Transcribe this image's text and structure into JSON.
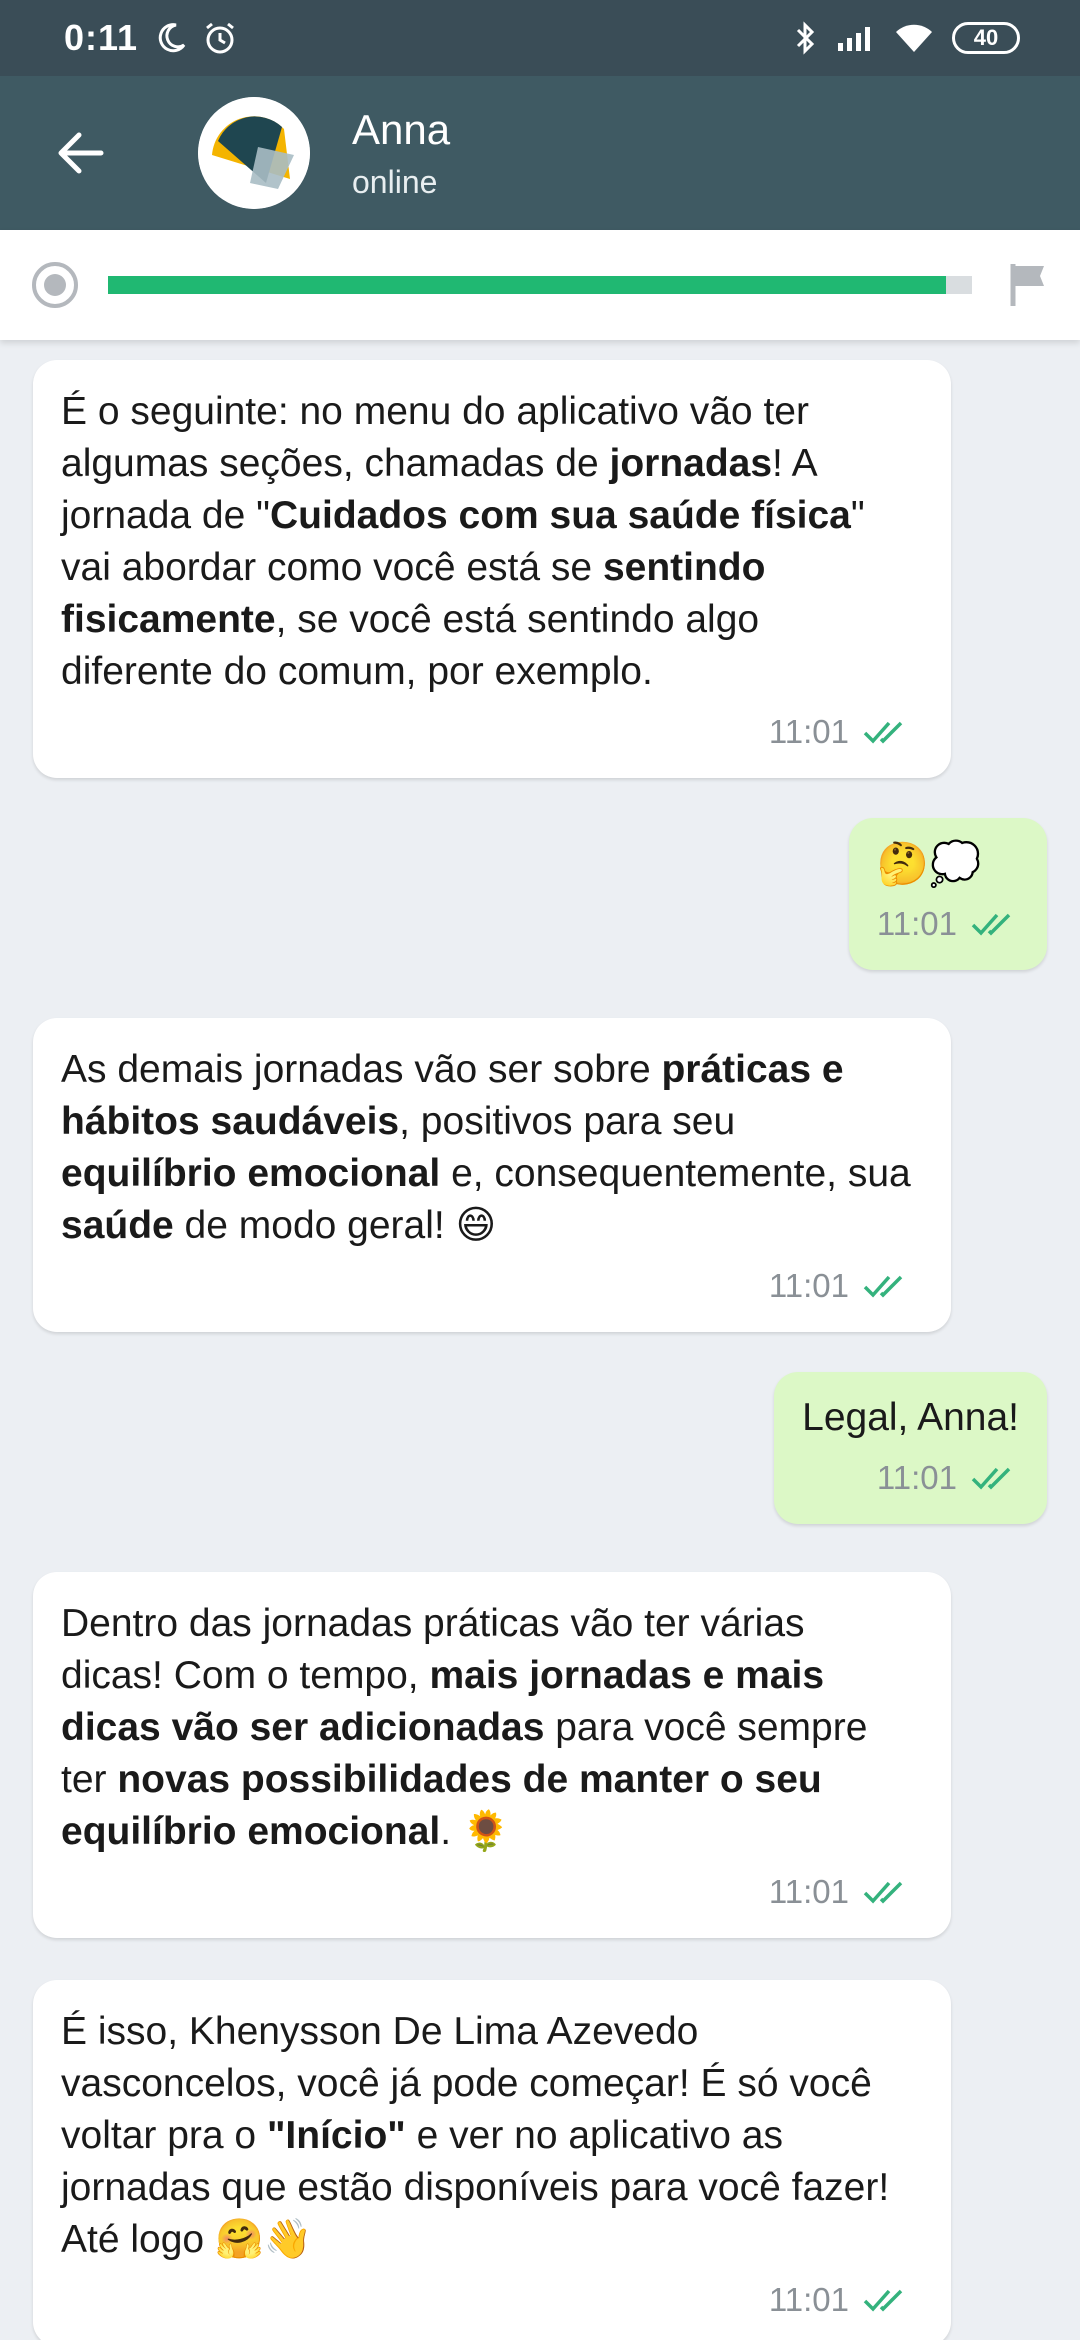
{
  "status_bar": {
    "time": "0:11",
    "battery": "40",
    "icons": [
      "moon-icon",
      "alarm-icon",
      "bluetooth-icon",
      "signal-icon",
      "wifi-icon",
      "battery-icon"
    ]
  },
  "header": {
    "back_icon": "arrow-left-icon",
    "contact_name": "Anna",
    "contact_status": "online"
  },
  "progress": {
    "fraction": 0.97,
    "start_icon": "record-icon",
    "end_icon": "flag-icon",
    "fill_color": "#20b872"
  },
  "messages": [
    {
      "direction": "incoming",
      "parts": [
        [
          "É o seguinte: no menu do aplicativo vão ter algumas seções, chamadas de ",
          false
        ],
        [
          "jornadas",
          true
        ],
        [
          "! A jornada de \"",
          false
        ],
        [
          "Cuidados com sua saúde física",
          true
        ],
        [
          "\" vai abordar como você está se ",
          false
        ],
        [
          "sentindo fisicamente",
          true
        ],
        [
          ", se você está sentindo algo diferente do comum, por exemplo.",
          false
        ]
      ],
      "time": "11:01"
    },
    {
      "direction": "outgoing",
      "parts": [
        [
          "🤔💭",
          false
        ]
      ],
      "time": "11:01"
    },
    {
      "direction": "incoming",
      "parts": [
        [
          "As demais jornadas vão ser sobre ",
          false
        ],
        [
          "práticas e hábitos saudáveis",
          true
        ],
        [
          ", positivos para seu ",
          false
        ],
        [
          "equilíbrio emocional",
          true
        ],
        [
          " e, consequentemente, sua ",
          false
        ],
        [
          "saúde",
          true
        ],
        [
          " de modo geral!  😄",
          false
        ]
      ],
      "time": "11:01"
    },
    {
      "direction": "outgoing",
      "parts": [
        [
          "Legal, Anna!",
          false
        ]
      ],
      "time": "11:01"
    },
    {
      "direction": "incoming",
      "parts": [
        [
          "Dentro das jornadas práticas vão ter várias dicas! Com o tempo, ",
          false
        ],
        [
          "mais jornadas e mais dicas vão ser adicionadas",
          true
        ],
        [
          " para você sempre ter ",
          false
        ],
        [
          "novas possibilidades de manter o seu equilíbrio emocional",
          true
        ],
        [
          ". 🌻",
          false
        ]
      ],
      "time": "11:01"
    },
    {
      "direction": "incoming",
      "parts": [
        [
          "É isso, Khenysson De Lima Azevedo vasconcelos, você já pode começar! É só você voltar pra o ",
          false
        ],
        [
          "\"Início\"",
          true
        ],
        [
          " e ver no aplicativo as jornadas que estão disponíveis para você fazer! Até logo 🤗👋",
          false
        ]
      ],
      "time": "11:01"
    }
  ],
  "colors": {
    "status_bar": "#3a4d57",
    "header": "#3f5a63",
    "chat_bg": "#eceff3",
    "incoming_bubble": "#ffffff",
    "outgoing_bubble": "#dcf8c6",
    "read_ticks": "#34b27d"
  }
}
